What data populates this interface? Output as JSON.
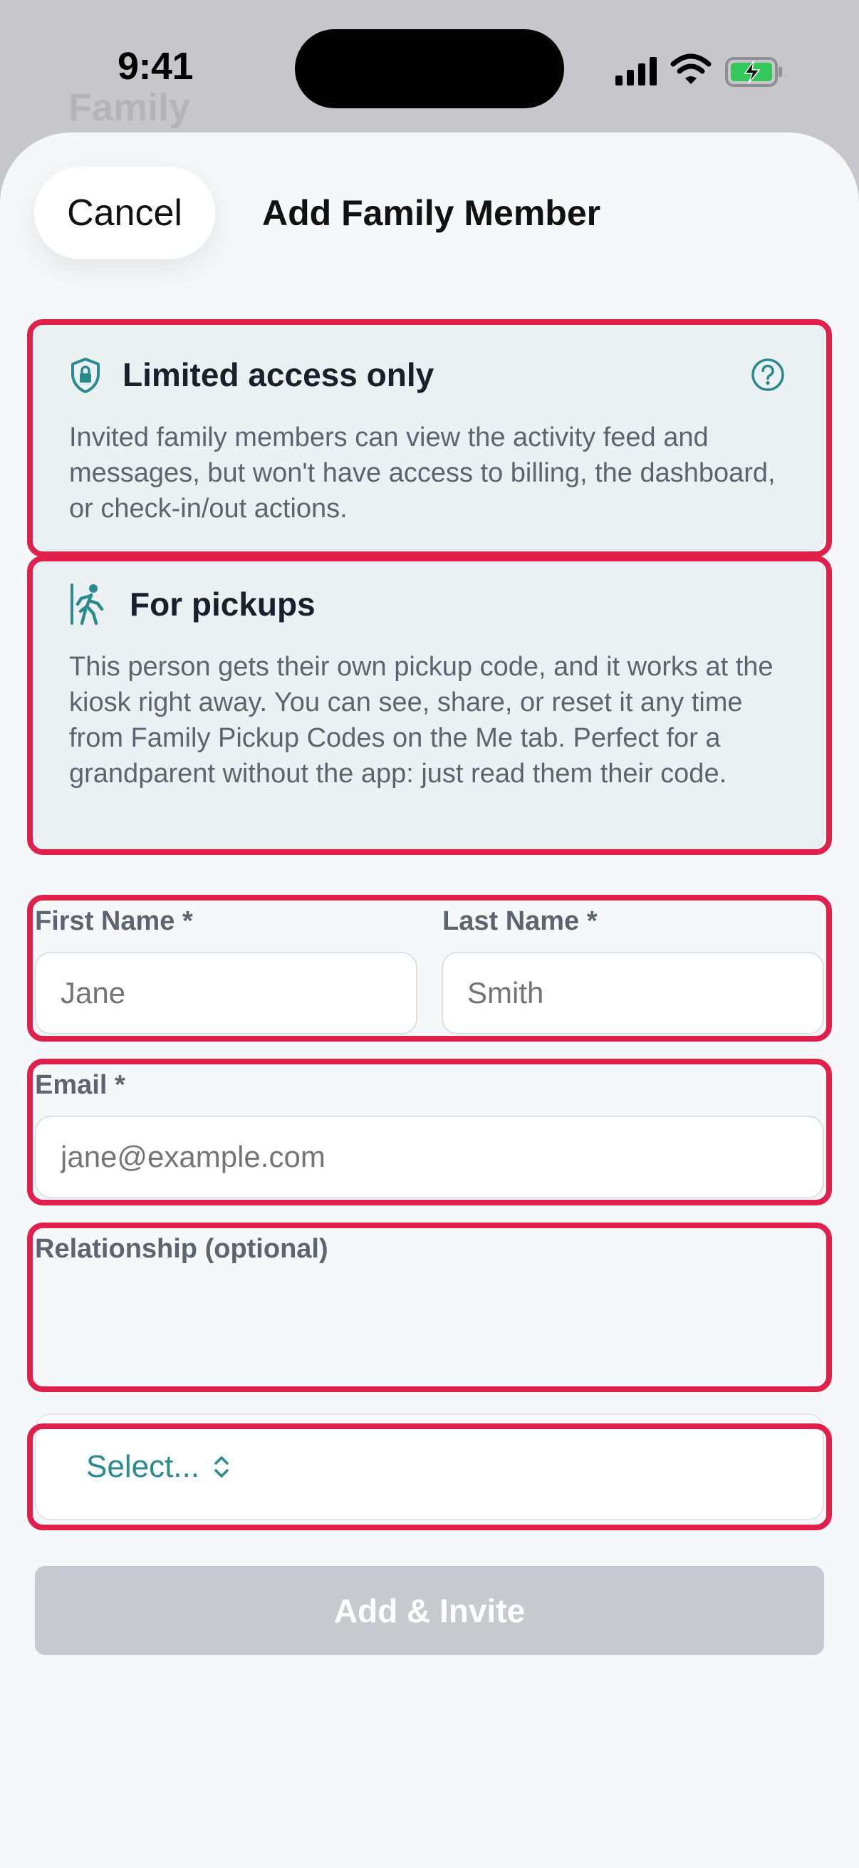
{
  "status_bar": {
    "time": "9:41"
  },
  "background": {
    "title": "Family"
  },
  "sheet": {
    "cancel_label": "Cancel",
    "title": "Add Family Member"
  },
  "info_cards": {
    "limited_access": {
      "title": "Limited access only",
      "body": "Invited family members can view the activity feed and messages, but won't have access to billing, the dashboard, or check-in/out actions.",
      "icon": "shield-lock-icon",
      "help_icon": "help-circle-icon"
    },
    "pickups": {
      "title": "For pickups",
      "body": "This person gets their own pickup code, and it works at the kiosk right away. You can see, share, or reset it any time from Family Pickup Codes on the Me tab. Perfect for a grandparent without the app: just read them their code.",
      "icon": "walking-person-icon"
    }
  },
  "form": {
    "first_name": {
      "label": "First Name *",
      "placeholder": "Jane"
    },
    "last_name": {
      "label": "Last Name *",
      "placeholder": "Smith"
    },
    "email": {
      "label": "Email *",
      "placeholder": "jane@example.com"
    },
    "relationship": {
      "label": "Relationship (optional)",
      "value": "Select..."
    },
    "submit_label": "Add & Invite"
  },
  "colors": {
    "accent": "#2a8a90",
    "highlight": "#e0204a",
    "card_background": "#ebf1f3",
    "disabled_button": "#c8c9ce"
  }
}
